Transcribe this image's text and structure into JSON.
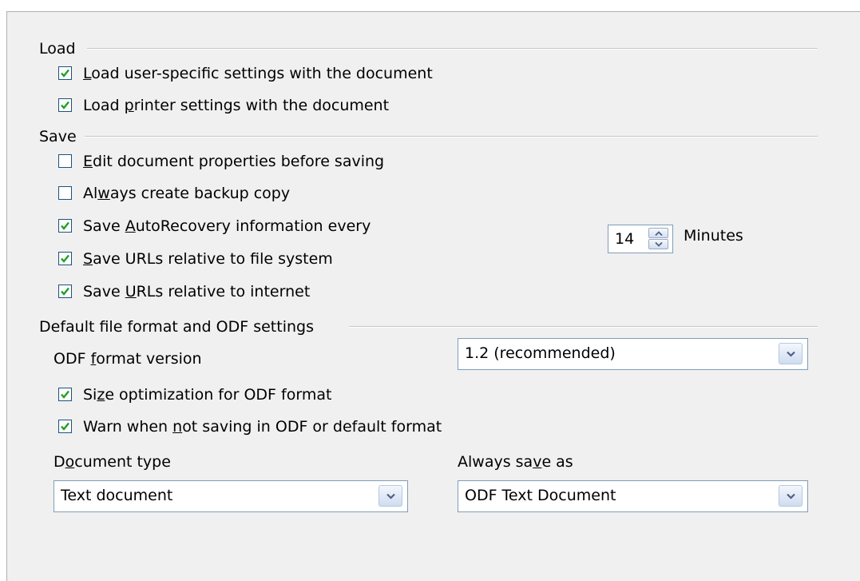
{
  "load": {
    "title": "Load",
    "user_settings": {
      "pre": "",
      "ul": "L",
      "post": "oad user-specific settings with the document",
      "checked": true
    },
    "printer_settings": {
      "pre": "Load ",
      "ul": "p",
      "post": "rinter settings with the document",
      "checked": true
    }
  },
  "save": {
    "title": "Save",
    "edit_properties": {
      "pre": "",
      "ul": "E",
      "post": "dit document properties before saving",
      "checked": false
    },
    "backup_copy": {
      "pre": "Al",
      "ul": "w",
      "post": "ays create backup copy",
      "checked": false
    },
    "autorecovery": {
      "pre": "Save ",
      "ul": "A",
      "post": "utoRecovery information every",
      "checked": true
    },
    "autorecovery_minutes": "14",
    "minutes_label": "Minutes",
    "urls_file_system": {
      "pre": "",
      "ul": "S",
      "post": "ave URLs relative to file system",
      "checked": true
    },
    "urls_internet": {
      "pre": "Save ",
      "ul": "U",
      "post": "RLs relative to internet",
      "checked": true
    }
  },
  "default_format": {
    "title": "Default file format and ODF settings",
    "odf_version_label": {
      "pre": "ODF ",
      "ul": "f",
      "post": "ormat version"
    },
    "odf_version_value": "1.2 (recommended)",
    "size_optimization": {
      "pre": "Si",
      "ul": "z",
      "post": "e optimization for ODF format",
      "checked": true
    },
    "warn_not_odf": {
      "pre": "Warn when ",
      "ul": "n",
      "post": "ot saving in ODF or default format",
      "checked": true
    },
    "document_type_label": {
      "pre": "D",
      "ul": "o",
      "post": "cument type"
    },
    "document_type_value": "Text document",
    "always_save_as_label": {
      "pre": "Always sa",
      "ul": "v",
      "post": "e as"
    },
    "always_save_as_value": "ODF Text Document"
  },
  "colors": {
    "check": "#21a121",
    "checkbox_border": "#1c5180",
    "panel_bg": "#f0f0f0",
    "field_border": "#7f9db9"
  }
}
